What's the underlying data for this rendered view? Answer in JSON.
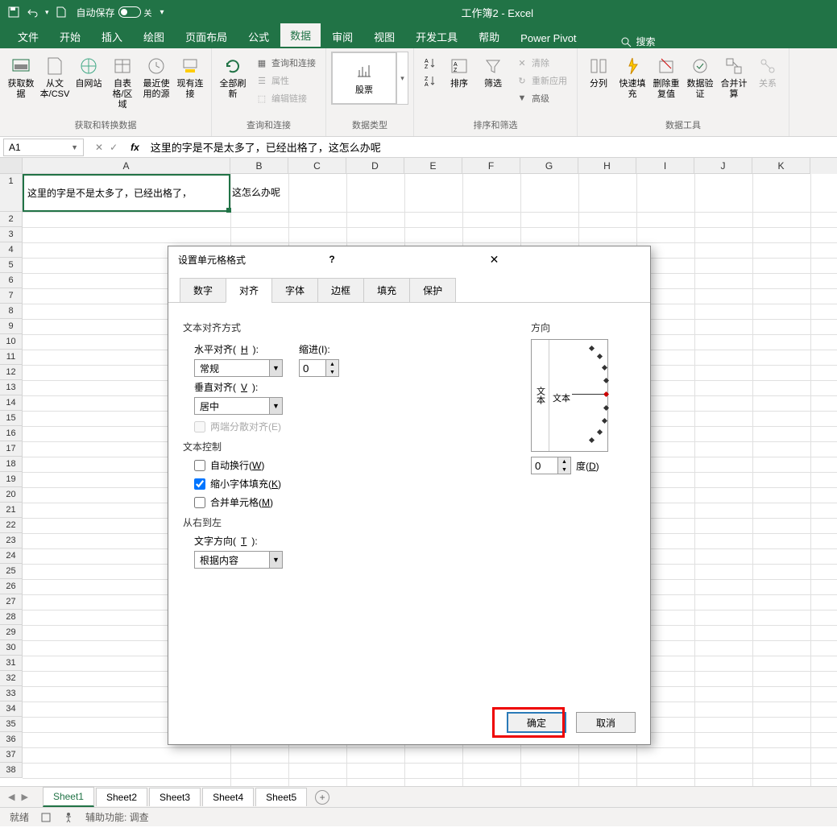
{
  "titlebar": {
    "autosave_label": "自动保存",
    "autosave_state": "关",
    "doc_title": "工作簿2  -  Excel"
  },
  "ribbon": {
    "tabs": [
      "文件",
      "开始",
      "插入",
      "绘图",
      "页面布局",
      "公式",
      "数据",
      "审阅",
      "视图",
      "开发工具",
      "帮助",
      "Power Pivot"
    ],
    "active_tab": "数据",
    "search_label": "搜索",
    "groups": {
      "g1": {
        "label": "获取和转换数据",
        "btns": [
          "获取数据",
          "从文本/CSV",
          "自网站",
          "自表格/区域",
          "最近使用的源",
          "现有连接"
        ]
      },
      "g2": {
        "label": "查询和连接",
        "refresh": "全部刷新",
        "items": [
          "查询和连接",
          "属性",
          "编辑链接"
        ]
      },
      "g3": {
        "label": "数据类型",
        "stock": "股票"
      },
      "g4": {
        "label": "排序和筛选",
        "sort": "排序",
        "filter": "筛选",
        "items": [
          "清除",
          "重新应用",
          "高级"
        ]
      },
      "g5": {
        "label": "数据工具",
        "btns": [
          "分列",
          "快速填充",
          "删除重复值",
          "数据验证",
          "合并计算",
          "关系"
        ]
      }
    }
  },
  "formula_bar": {
    "namebox": "A1",
    "value": "这里的字是不是太多了，已经出格了，这怎么办呢"
  },
  "grid": {
    "columns": [
      "A",
      "B",
      "C",
      "D",
      "E",
      "F",
      "G",
      "H",
      "I",
      "J",
      "K"
    ],
    "row_count": 38,
    "a1_text": "这里的字是不是太多了，已经出格了，",
    "overflow": "这怎么办呢"
  },
  "dialog": {
    "title": "设置单元格格式",
    "tabs": [
      "数字",
      "对齐",
      "字体",
      "边框",
      "填充",
      "保护"
    ],
    "active_tab": "对齐",
    "sec_align": "文本对齐方式",
    "horiz_label_pre": "水平对齐(",
    "horiz_label_u": "H",
    "horiz_label_post": "):",
    "horiz_value": "常规",
    "indent_label": "缩进(I):",
    "indent_value": "0",
    "vert_label_pre": "垂直对齐(",
    "vert_label_u": "V",
    "vert_label_post": "):",
    "vert_value": "居中",
    "justify_dist": "两端分散对齐(E)",
    "sec_ctrl": "文本控制",
    "wrap_pre": "自动换行(",
    "wrap_u": "W",
    "wrap_post": ")",
    "shrink_pre": "缩小字体填充(",
    "shrink_u": "K",
    "shrink_post": ")",
    "merge_pre": "合并单元格(",
    "merge_u": "M",
    "merge_post": ")",
    "sec_rtl": "从右到左",
    "textdir_label_pre": "文字方向(",
    "textdir_label_u": "T",
    "textdir_label_post": "):",
    "textdir_value": "根据内容",
    "orient_header": "方向",
    "orient_v": "文本",
    "orient_lbl": "文本",
    "deg_value": "0",
    "deg_label_pre": "度(",
    "deg_label_u": "D",
    "deg_label_post": ")",
    "ok": "确定",
    "cancel": "取消"
  },
  "sheets": {
    "tabs": [
      "Sheet1",
      "Sheet2",
      "Sheet3",
      "Sheet4",
      "Sheet5"
    ],
    "active": "Sheet1"
  },
  "statusbar": {
    "ready": "就绪",
    "acc": "辅助功能: 调查"
  }
}
